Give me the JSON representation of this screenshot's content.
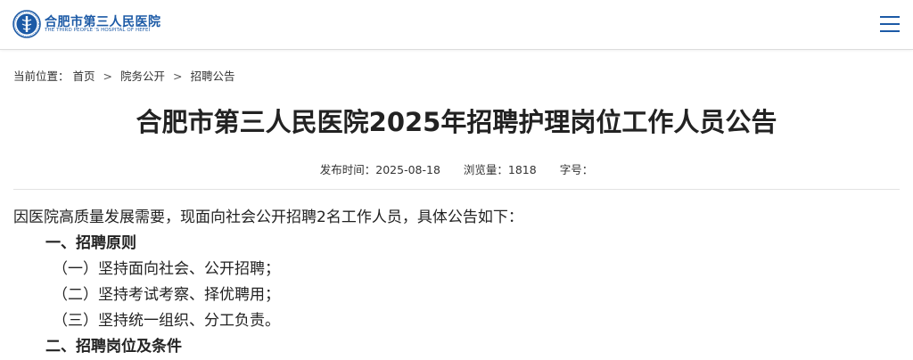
{
  "header": {
    "logo_name": "合肥市第三人民医院",
    "logo_subtitle": "THE THIRD PEOPLE 'S HOSPITAL OF HEFEI",
    "logo_icon": "hospital-emblem-icon",
    "menu_icon": "hamburger-menu-icon",
    "brand_color": "#1c5aa6"
  },
  "breadcrumb": {
    "prefix": "当前位置：",
    "items": [
      "首页",
      "院务公开",
      "招聘公告"
    ],
    "separator": ">"
  },
  "article": {
    "title": "合肥市第三人民医院2025年招聘护理岗位工作人员公告",
    "publish_time": "发布时间：2025-08-18",
    "views": "浏览量：1818",
    "font_size_label": "字号：",
    "paragraphs": [
      {
        "type": "text",
        "text": "因医院高质量发展需要，现面向社会公开招聘2名工作人员，具体公告如下："
      },
      {
        "type": "heading",
        "text": "一、招聘原则"
      },
      {
        "type": "sub",
        "text": "（一）坚持面向社会、公开招聘；"
      },
      {
        "type": "sub",
        "text": "（二）坚持考试考察、择优聘用；"
      },
      {
        "type": "sub",
        "text": "（三）坚持统一组织、分工负责。"
      },
      {
        "type": "heading",
        "text": "二、招聘岗位及条件"
      }
    ]
  }
}
